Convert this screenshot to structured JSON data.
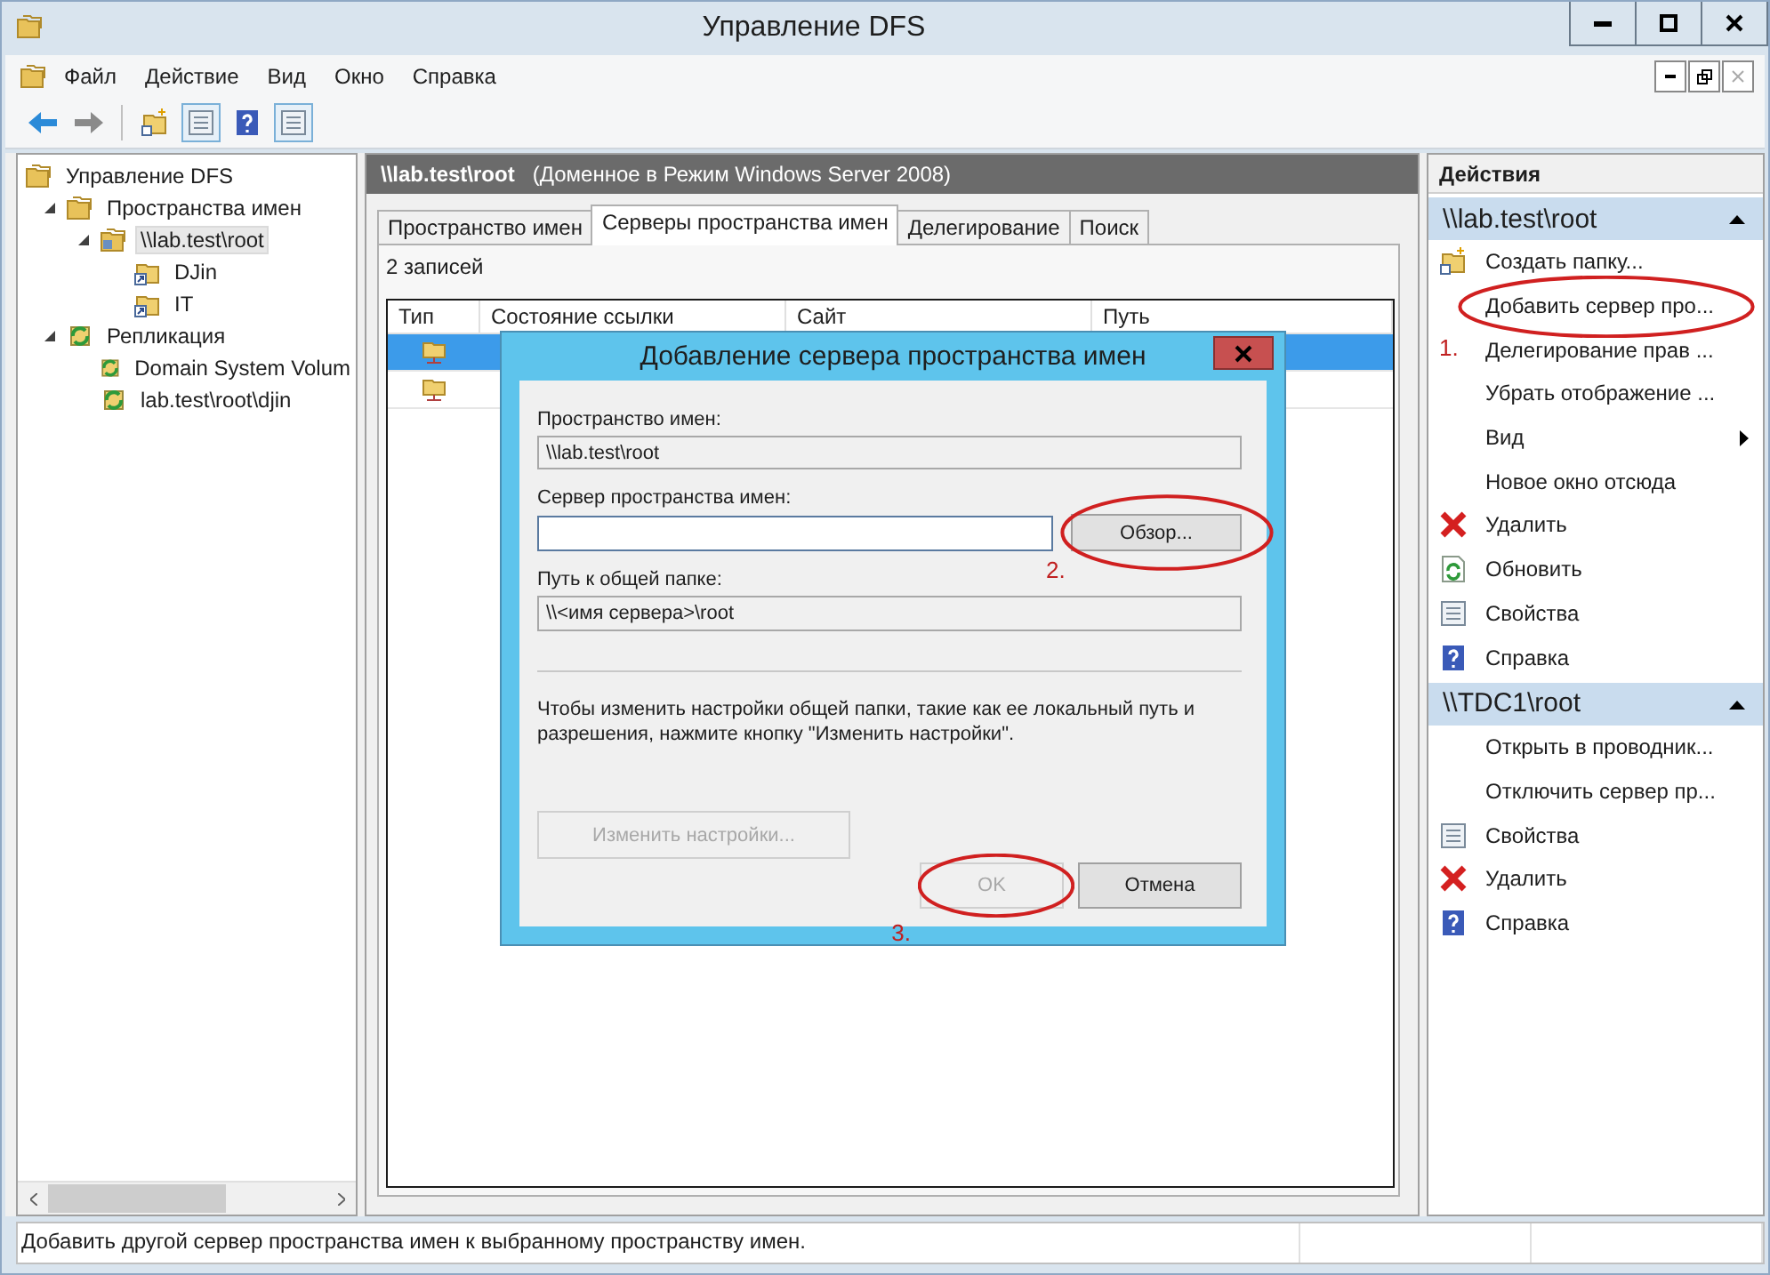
{
  "window": {
    "title": "Управление DFS"
  },
  "menu": [
    "Файл",
    "Действие",
    "Вид",
    "Окно",
    "Справка"
  ],
  "tree": [
    {
      "label": "Управление DFS",
      "kind": "dfs",
      "selected": false,
      "children": [
        {
          "label": "Пространства имен",
          "kind": "namespaces",
          "expanded": true,
          "selected": false,
          "children": [
            {
              "label": "\\\\lab.test\\root",
              "kind": "namespace",
              "expanded": true,
              "selected": true,
              "children": [
                {
                  "label": "DJin",
                  "kind": "folder",
                  "selected": false
                },
                {
                  "label": "IT",
                  "kind": "folder",
                  "selected": false
                }
              ]
            }
          ]
        },
        {
          "label": "Репликация",
          "kind": "replication",
          "expanded": true,
          "selected": false,
          "children": [
            {
              "label": "Domain System Volum",
              "kind": "replication",
              "selected": false
            },
            {
              "label": "lab.test\\root\\djin",
              "kind": "replication",
              "selected": false
            }
          ]
        }
      ]
    }
  ],
  "header": {
    "path": "\\\\lab.test\\root",
    "mode": "(Доменное в Режим Windows Server 2008)"
  },
  "tabs": [
    {
      "label": "Пространство имен",
      "selected": false
    },
    {
      "label": "Серверы пространства имен",
      "selected": true
    },
    {
      "label": "Делегирование",
      "selected": false
    },
    {
      "label": "Поиск",
      "selected": false
    }
  ],
  "record_count": "2 записей",
  "table": {
    "columns": [
      "Тип",
      "Состояние ссылки",
      "Сайт",
      "Путь"
    ],
    "rows": [
      {
        "selected": true
      },
      {
        "selected": false
      }
    ]
  },
  "actions": [
    {
      "title": "Действия"
    },
    {
      "title": "\\\\lab.test\\root",
      "expanded": true,
      "items": [
        {
          "label": "Создать папку...",
          "kind": "new-folder"
        },
        {
          "label": "Добавить сервер про...",
          "kind": "plain",
          "circled": true
        },
        {
          "label": "Делегирование прав ...",
          "kind": "plain",
          "annotation": "1."
        },
        {
          "label": "Убрать отображение ...",
          "kind": "plain"
        },
        {
          "label": "Вид",
          "kind": "plain",
          "submenu": true
        },
        {
          "label": "Новое окно отсюда",
          "kind": "plain"
        },
        {
          "label": "Удалить",
          "kind": "delete"
        },
        {
          "label": "Обновить",
          "kind": "refresh"
        },
        {
          "label": "Свойства",
          "kind": "properties"
        },
        {
          "label": "Справка",
          "kind": "help"
        }
      ]
    },
    {
      "title": "\\\\TDC1\\root",
      "expanded": true,
      "items": [
        {
          "label": "Открыть в проводник...",
          "kind": "plain"
        },
        {
          "label": "Отключить сервер пр...",
          "kind": "plain"
        },
        {
          "label": "Свойства",
          "kind": "properties"
        },
        {
          "label": "Удалить",
          "kind": "delete"
        },
        {
          "label": "Справка",
          "kind": "help"
        }
      ]
    }
  ],
  "status_bar": "Добавить другой сервер пространства имен к выбранному пространству имен.",
  "dialog": {
    "title": "Добавление сервера пространства имен",
    "namespace_label": "Пространство имен:",
    "namespace_value": "\\\\lab.test\\root",
    "server_label": "Сервер пространства имен:",
    "browse": {
      "label": "Обзор...",
      "circled": true,
      "annotation": "2."
    },
    "share_label": "Путь к общей папке:",
    "share_value": "\\\\<имя сервера>\\root",
    "note": "Чтобы изменить настройки общей папки, такие как ее локальный путь и разрешения, нажмите кнопку \"Изменить настройки\".",
    "edit_settings": {
      "label": "Изменить настройки...",
      "disabled": true
    },
    "ok": {
      "label": "OK",
      "disabled": true,
      "circled": true,
      "annotation": "3."
    },
    "cancel": {
      "label": "Отмена",
      "disabled": false
    }
  }
}
